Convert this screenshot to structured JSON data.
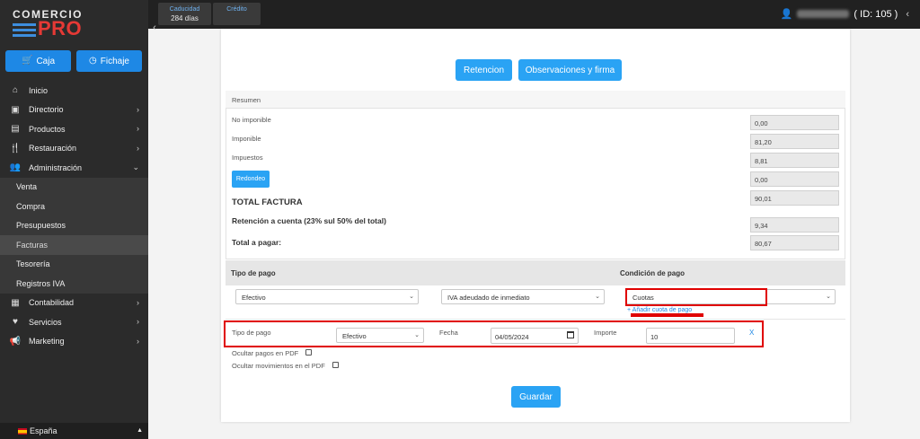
{
  "brand": {
    "line1": "COMERCIO",
    "line2": "PRO"
  },
  "sidebar": {
    "caja_label": "Caja",
    "fichaje_label": "Fichaje",
    "menu": [
      {
        "label": "Inicio",
        "icon": "home-icon"
      },
      {
        "label": "Directorio",
        "icon": "id-card-icon"
      },
      {
        "label": "Productos",
        "icon": "box-icon"
      },
      {
        "label": "Restauración",
        "icon": "utensils-icon"
      },
      {
        "label": "Administración",
        "icon": "users-icon"
      }
    ],
    "submenu": [
      "Venta",
      "Compra",
      "Presupuestos",
      "Facturas",
      "Tesorería",
      "Registros IVA"
    ],
    "menu2": [
      {
        "label": "Contabilidad",
        "icon": "calculator-icon"
      },
      {
        "label": "Servicios",
        "icon": "heart-icon"
      },
      {
        "label": "Marketing",
        "icon": "megaphone-icon"
      }
    ],
    "language": "España"
  },
  "topbar": {
    "caducidad_label": "Caducidad",
    "caducidad_value": "284 días",
    "credito_label": "Crédito",
    "user_id": "( ID: 105 )"
  },
  "actions": {
    "retencion": "Retencion",
    "observaciones": "Observaciones y firma",
    "guardar": "Guardar"
  },
  "resumen": {
    "title": "Resumen",
    "no_imponible_label": "No imponible",
    "no_imponible": "0,00",
    "imponible_label": "Imponible",
    "imponible": "81,20",
    "impuestos_label": "Impuestos",
    "impuestos": "8,81",
    "redondeo_label": "Redondeo",
    "redondeo": "0,00",
    "total_label": "TOTAL FACTURA",
    "total": "90,01",
    "retencion_label": "Retención a cuenta (23% sul 50% del total)",
    "retencion": "9,34",
    "pagar_label": "Total a pagar:",
    "pagar": "80,67"
  },
  "pago": {
    "tipo_header": "Tipo de pago",
    "condicion_header": "Condición de pago",
    "tipo_value": "Efectivo",
    "iva_value": "IVA adeudado de inmediato",
    "condicion_value": "Cuotas",
    "add_cuota": "+ Añadir cuota de pago"
  },
  "cuota": {
    "tipo_label": "Tipo de pago",
    "tipo_value": "Efectivo",
    "fecha_label": "Fecha",
    "fecha_value": "04/05/2024",
    "importe_label": "Importe",
    "importe_value": "10",
    "remove": "X"
  },
  "options": {
    "ocultar_pagos": "Ocultar pagos en PDF",
    "ocultar_mov": "Ocultar movimientos en el PDF"
  }
}
